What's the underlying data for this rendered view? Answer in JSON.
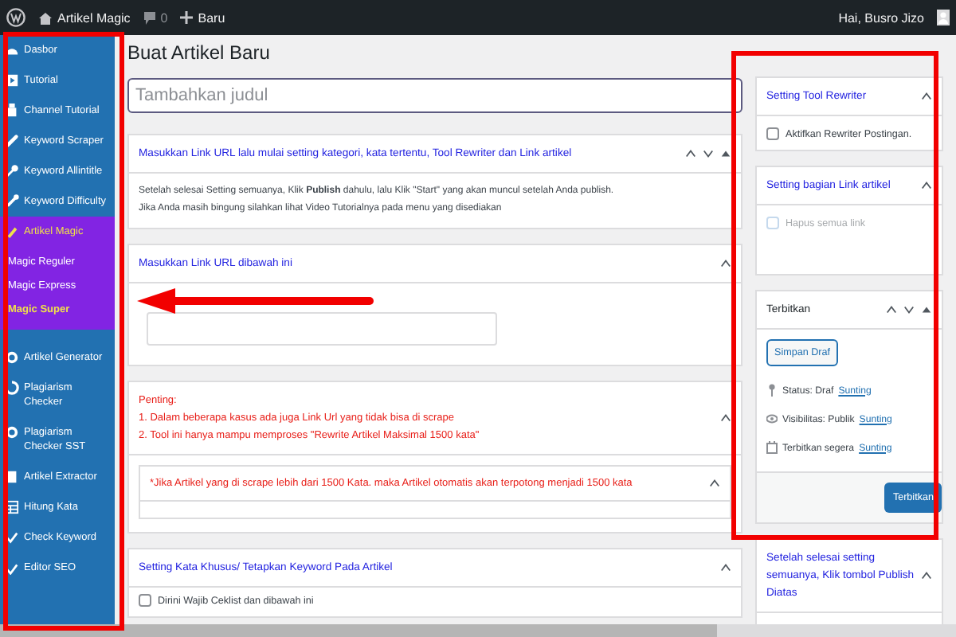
{
  "top_bar": {
    "site_name": "Artikel Magic",
    "comments": "0",
    "new_label": "Baru",
    "greeting": "Hai, Busro Jizo"
  },
  "sidebar": {
    "items": [
      {
        "label": "Dasbor",
        "selected": false
      },
      {
        "label": "Tutorial",
        "selected": false
      },
      {
        "label": "Channel Tutorial",
        "selected": false
      },
      {
        "label": "Keyword Scraper",
        "selected": false
      },
      {
        "label": "Keyword Allintitle",
        "selected": false
      },
      {
        "label": "Keyword Difficulty",
        "selected": false
      },
      {
        "label": "Artikel Magic",
        "selected": true,
        "children": [
          {
            "label": "Magic Reguler",
            "selected": false
          },
          {
            "label": "Magic Express",
            "selected": false
          },
          {
            "label": "Magic Super",
            "selected": true
          }
        ]
      },
      {
        "label": "Artikel Generator",
        "selected": false
      },
      {
        "label": "Plagiarism Checker",
        "selected": false
      },
      {
        "label": "Plagiarism Checker SST",
        "selected": false
      },
      {
        "label": "Artikel Extractor",
        "selected": false
      },
      {
        "label": "Hitung Kata",
        "selected": false
      },
      {
        "label": "Check Keyword",
        "selected": false
      },
      {
        "label": "Editor SEO",
        "selected": false
      }
    ]
  },
  "page_title": "Buat Artikel Baru",
  "title_field": {
    "placeholder": "Tambahkan judul"
  },
  "main_boxes": [
    {
      "kind": "info",
      "movable": true,
      "title": "Masukkan Link URL lalu mulai setting kategori, kata tertentu, Tool Rewriter dan Link artikel",
      "lines": [
        "Setelah selesai Setting semuanya, Klik **Publish** dahulu, lalu Klik \"Start\" yang akan muncul setelah Anda publish.",
        "Jika Anda masih bingung silahkan lihat Video Tutorialnya pada menu yang disediakan"
      ]
    },
    {
      "kind": "input",
      "movable": false,
      "title": "Masukkan Link URL dibawah ini"
    },
    {
      "kind": "warning",
      "movable": false,
      "lines": [
        "Penting:",
        "1. Dalam beberapa kasus ada juga Link Url yang tidak bisa di scrape",
        "2. Tool ini hanya mampu memproses \"Rewrite Artikel Maksimal 1500 kata\""
      ],
      "note": "*Jika Artikel yang di scrape lebih dari 1500 Kata. maka Artikel otomatis akan terpotong menjadi 1500 kata"
    },
    {
      "kind": "checklist",
      "movable": false,
      "title": "Setting Kata Khusus/ Tetapkan Keyword Pada Artikel",
      "options": [
        {
          "label": "Dirini Wajib Ceklist dan dibawah ini",
          "checked": false
        }
      ]
    }
  ],
  "side_boxes": [
    {
      "kind": "checkbox",
      "movable": false,
      "title": "Setting Tool Rewriter",
      "options": [
        {
          "label": "Aktifkan Rewriter Postingan.",
          "checked": false,
          "disabled": false
        }
      ]
    },
    {
      "kind": "checkbox",
      "movable": false,
      "title": "Setting bagian Link artikel",
      "options": [
        {
          "label": "Hapus semua link",
          "checked": false,
          "disabled": true
        }
      ]
    },
    {
      "kind": "publish",
      "movable": true,
      "title": "Terbitkan",
      "save_button": "Simpan Draf",
      "meta": [
        {
          "label": "Status: Draf",
          "link": "Sunting"
        },
        {
          "label": "Visibilitas: Publik",
          "link": "Sunting"
        },
        {
          "label": "Terbitkan segera",
          "link": "Sunting"
        }
      ],
      "publish_button": "Terbitkan"
    },
    {
      "kind": "note",
      "movable": false,
      "title": "Setelah selesai setting semuanya, Klik tombol Publish Diatas"
    }
  ]
}
